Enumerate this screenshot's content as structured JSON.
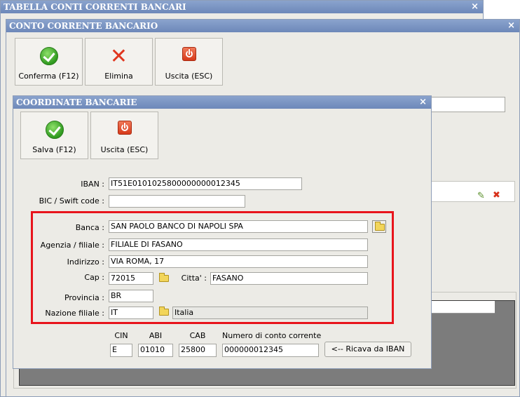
{
  "windows": {
    "tabella": {
      "title": "TABELLA CONTI CORRENTI BANCARI",
      "close": "×"
    },
    "conto": {
      "title": "CONTO CORRENTE BANCARIO",
      "close": "×",
      "toolbar": {
        "confirm": "Conferma (F12)",
        "delete": "Elimina",
        "exit": "Uscita (ESC)"
      }
    },
    "coordinate": {
      "title": "COORDINATE BANCARIE",
      "close": "×",
      "toolbar": {
        "save": "Salva (F12)",
        "exit": "Uscita (ESC)"
      }
    }
  },
  "form": {
    "iban": {
      "label": "IBAN :",
      "value": "IT51E0101025800000000012345"
    },
    "bic": {
      "label": "BIC / Swift code :",
      "value": ""
    },
    "banca": {
      "label": "Banca :",
      "value": "SAN PAOLO BANCO DI NAPOLI SPA"
    },
    "agenzia": {
      "label": "Agenzia / filiale :",
      "value": "FILIALE DI FASANO"
    },
    "indirizzo": {
      "label": "Indirizzo :",
      "value": "VIA ROMA, 17"
    },
    "cap": {
      "label": "Cap :",
      "value": "72015"
    },
    "citta": {
      "label": "Citta' :",
      "value": "FASANO"
    },
    "provincia": {
      "label": "Provincia :",
      "value": "BR"
    },
    "nazione": {
      "label": "Nazione filiale :",
      "code": "IT",
      "name": "Italia"
    }
  },
  "coords": {
    "cin": {
      "label": "CIN",
      "value": "E"
    },
    "abi": {
      "label": "ABI",
      "value": "01010"
    },
    "cab": {
      "label": "CAB",
      "value": "25800"
    },
    "conto": {
      "label": "Numero di conto corrente",
      "value": "000000012345"
    },
    "ricava": "<-- Ricava da IBAN"
  },
  "highlight_color": "#e8141c"
}
